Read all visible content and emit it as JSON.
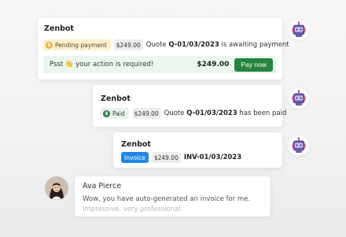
{
  "messages": [
    {
      "sender": "Zenbot",
      "badge_label": "Pending payment",
      "badge_icon": "$",
      "amount": "$249.00",
      "text_prefix": "Quote",
      "reference": "Q-01/03/2023",
      "text_suffix": "is awaiting payment",
      "action_text": "Psst 👋 your action is required!",
      "action_amount": "$249.00",
      "action_button": "Pay now"
    },
    {
      "sender": "Zenbot",
      "badge_label": "Paid",
      "badge_icon": "$",
      "amount": "$249.00",
      "text_prefix": "Quote",
      "reference": "Q-01/03/2023",
      "text_suffix": "has been paid"
    },
    {
      "sender": "Zenbot",
      "badge_label": "Invoice",
      "amount": "$249.00",
      "reference": "INV-01/03/2023"
    },
    {
      "sender": "Ava Pierce",
      "line1": "Wow, you have auto-generated an invoice for me.",
      "line2": "Impressive, very professional."
    }
  ],
  "colors": {
    "pay_button": "#25843f",
    "invoice_badge": "#1e88e5",
    "pending_badge": "#fdf0cf",
    "action_bar": "#eaf6ee"
  },
  "icons": {
    "bot_avatar": "robot-icon",
    "user_avatar": "user-photo"
  }
}
